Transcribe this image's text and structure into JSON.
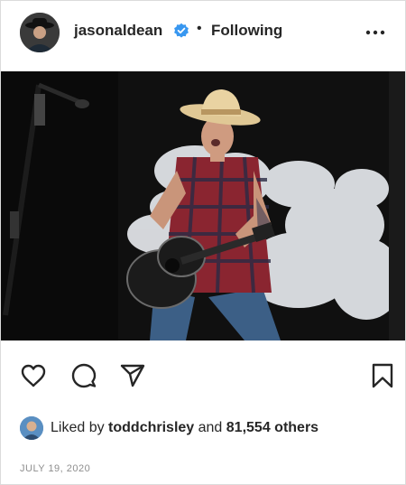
{
  "post": {
    "username": "jasonaldean",
    "separator": "•",
    "follow_status": "Following",
    "likes": {
      "prefix": "Liked by ",
      "user": "toddchrisley",
      "middle": " and ",
      "count": "81,554 others"
    },
    "date": "JULY 19, 2020"
  },
  "icons": {
    "verified": "verified-badge-icon",
    "more": "more-options-icon",
    "like": "heart-icon",
    "comment": "comment-icon",
    "share": "paper-plane-icon",
    "save": "bookmark-icon"
  },
  "colors": {
    "verified_blue": "#3897f0",
    "text": "#262626",
    "muted": "#8e8e8e",
    "border": "#dbdbdb"
  }
}
